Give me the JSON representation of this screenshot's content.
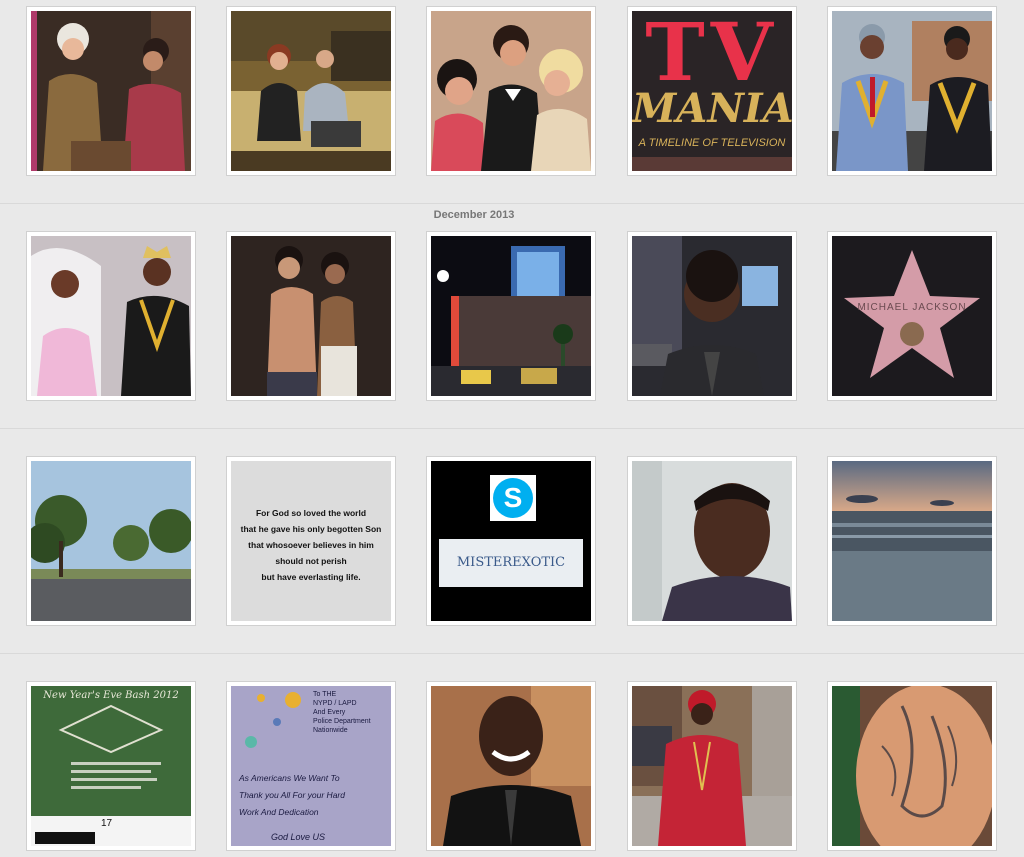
{
  "timeline": {
    "month_label": "December 2013"
  },
  "tiles": {
    "tv_mania": {
      "line1": "TV",
      "line2": "MANIA",
      "line3": "A TIMELINE OF TELEVISION"
    },
    "walk_of_fame": {
      "star_name": "MICHAEL JACKSON"
    },
    "verse": {
      "lines": [
        "For God so loved the world",
        "that he gave his only begotten Son",
        "that whosoever believes in him",
        "should not perish",
        "but have everlasting life."
      ]
    },
    "skype": {
      "username": "MISTEREXOTIC"
    },
    "flyer": {
      "heading": "New Year's Eve Bash 2012",
      "badge_number": "17"
    },
    "note": {
      "header_lines": [
        "To THE",
        "NYPD / LAPD",
        "And Every",
        "Police Department",
        "Nationwide"
      ],
      "body_lines": [
        "As Americans We Want To",
        "Thank you All For your Hard",
        "Work And Dedication"
      ],
      "closing": "God Love US"
    }
  },
  "colors": {
    "background": "#e9e9e9",
    "tile_border": "#d0d0d0",
    "tv_red": "#e8324a",
    "tv_gold": "#d8b25a",
    "skype_blue": "#00aff0"
  }
}
